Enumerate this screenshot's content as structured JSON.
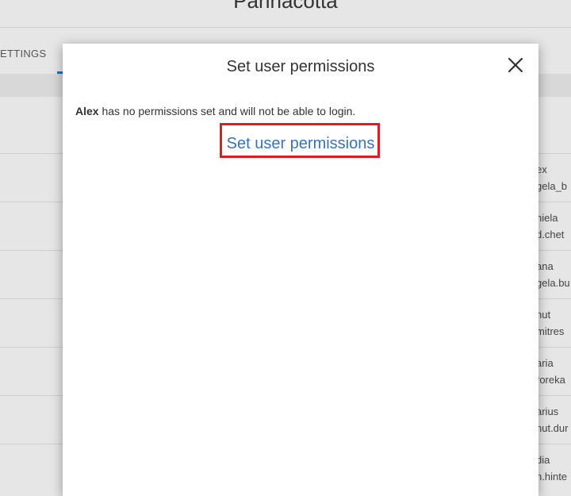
{
  "background": {
    "app_title": "Pannacotta",
    "tab_label": "ETTINGS",
    "user_rows": [
      {
        "line1": "ex",
        "line2": "gela_b"
      },
      {
        "line1": "niela",
        "line2": "d.chet"
      },
      {
        "line1": "ana",
        "line2": "gela.bu"
      },
      {
        "line1": "hut",
        "line2": "mitres"
      },
      {
        "line1": "aria",
        "line2": "roreka"
      },
      {
        "line1": "arius",
        "line2": "hut.dur"
      },
      {
        "line1": "dia",
        "line2": "n.hinte"
      }
    ]
  },
  "modal": {
    "title": "Set user permissions",
    "user_name": "Alex",
    "message_rest": " has no permissions set and will not be able to login.",
    "action_link": "Set user permissions",
    "highlight_color": "#e21b23",
    "link_color": "#3a73b5"
  }
}
